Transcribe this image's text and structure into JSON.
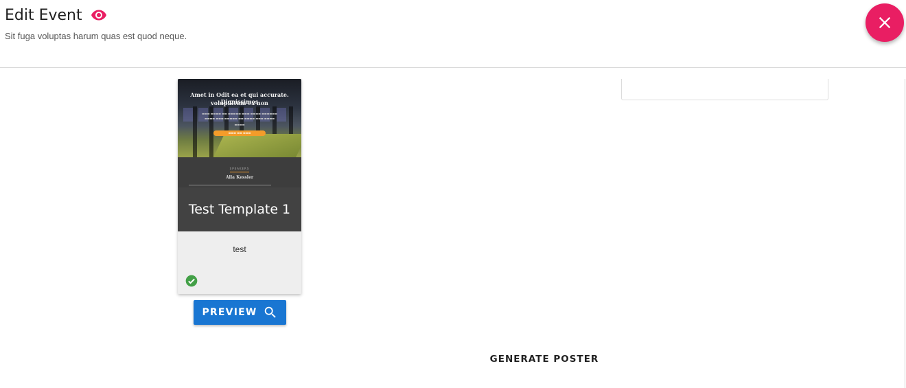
{
  "header": {
    "title": "Edit Event",
    "subtitle": "Sit fuga voluptas harum quas est quod neque.",
    "view_icon": "eye-icon",
    "close_icon": "close-icon"
  },
  "template_card": {
    "preview_heading_line1": "Amet in Odit ea et qui accurate. Dignissimos",
    "preview_heading_line2": "voluptatum ex non",
    "speaker_kicker": "SPEAKERS",
    "speaker_name": "Alla Kessler",
    "name": "Test Template 1",
    "description": "test",
    "selected_icon": "check-circle-icon"
  },
  "actions": {
    "preview_label": "PREVIEW",
    "preview_icon": "search-icon",
    "generate_label": "GENERATE POSTER"
  },
  "colors": {
    "accent": "#e91e63",
    "primary": "#1976d2",
    "success": "#43a047"
  }
}
